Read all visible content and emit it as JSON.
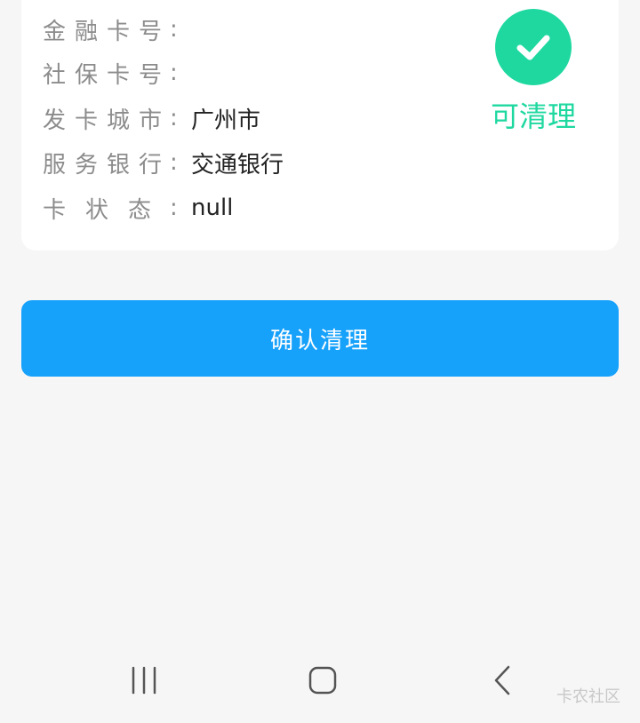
{
  "card": {
    "rows": [
      {
        "label": "金融卡号",
        "colon": ":",
        "value": ""
      },
      {
        "label": "社保卡号",
        "colon": ":",
        "value": ""
      },
      {
        "label": "发卡城市",
        "colon": ":",
        "value": "广州市"
      },
      {
        "label": "服务银行",
        "colon": ":",
        "value": "交通银行"
      },
      {
        "label": "卡状态",
        "colon": ":",
        "value": "null"
      }
    ],
    "status": {
      "icon": "check-icon",
      "text": "可清理",
      "color": "#1fd8a0"
    }
  },
  "actions": {
    "confirm_label": "确认清理",
    "confirm_color": "#16a1fb"
  },
  "navbar": {
    "recent_icon": "recent-apps-icon",
    "home_icon": "home-icon",
    "back_icon": "back-icon"
  },
  "watermark": "卡农社区"
}
